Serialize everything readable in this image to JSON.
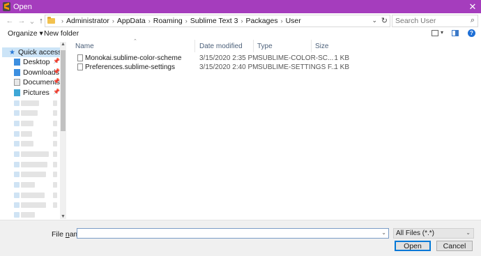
{
  "window": {
    "title": "Open",
    "close_glyph": "✕",
    "app_icon": "sublime-text-icon",
    "title_color": "#a53dbd"
  },
  "address": {
    "back_glyph": "←",
    "forward_glyph": "→",
    "recent_glyph": "⌄",
    "up_glyph": "↑",
    "crumbs": [
      "Administrator",
      "AppData",
      "Roaming",
      "Sublime Text 3",
      "Packages",
      "User"
    ],
    "separator": "›",
    "dropdown_glyph": "⌄",
    "refresh_glyph": "↻",
    "search_placeholder": "Search User",
    "search_glyph": "⌕"
  },
  "toolbar": {
    "organize_label": "Organize ▾",
    "new_folder_label": "New folder",
    "view_dd_glyph": "▾",
    "help_glyph": "?"
  },
  "navpane": {
    "quick_access_label": "Quick access",
    "star_glyph": "★",
    "pin_glyph": "📌",
    "pinned": [
      {
        "label": "Desktop",
        "icon": "desktop-folder-icon"
      },
      {
        "label": "Downloads",
        "icon": "downloads-folder-icon"
      },
      {
        "label": "Documents",
        "icon": "documents-folder-icon"
      },
      {
        "label": "Pictures",
        "icon": "pictures-folder-icon"
      }
    ],
    "scroll_up_glyph": "▲",
    "scroll_down_glyph": "▼"
  },
  "filelist": {
    "columns": {
      "name": "Name",
      "date": "Date modified",
      "type": "Type",
      "size": "Size"
    },
    "sort_glyph": "⌃",
    "rows": [
      {
        "name": "Monokai.sublime-color-scheme",
        "date": "3/15/2020 2:35 PM",
        "type": "SUBLIME-COLOR-SC...",
        "size": "1 KB"
      },
      {
        "name": "Preferences.sublime-settings",
        "date": "3/15/2020 2:40 PM",
        "type": "SUBLIME-SETTINGS F...",
        "size": "1 KB"
      }
    ]
  },
  "bottom": {
    "file_name_label_pre": "File ",
    "file_name_label_u": "n",
    "file_name_label_post": "ame:",
    "file_name_value": "",
    "file_name_dd_glyph": "⌄",
    "filter_value": "All Files (*.*)",
    "filter_dd_glyph": "⌄",
    "open_label": "Open",
    "cancel_label": "Cancel"
  }
}
